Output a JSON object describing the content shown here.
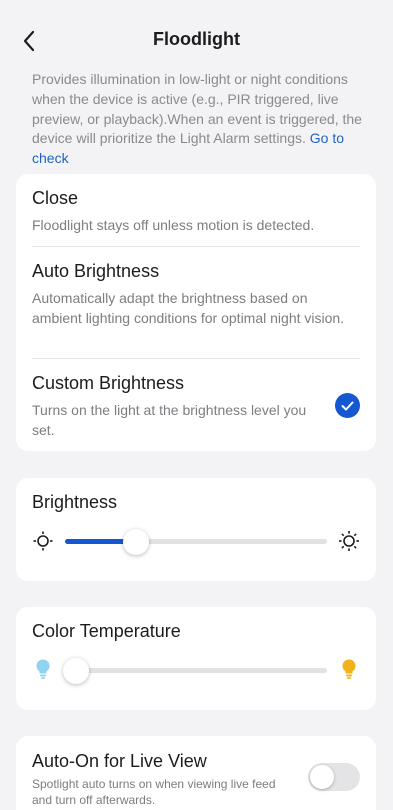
{
  "header": {
    "title": "Floodlight",
    "back_icon": "chevron-left-icon"
  },
  "description": {
    "text": "Provides illumination in low-light or night conditions when the device is active (e.g., PIR triggered, live preview, or playback).When an event is triggered, the device will prioritize the Light Alarm settings. ",
    "link": "Go to check"
  },
  "modes": [
    {
      "title": "Close",
      "subtitle": "Floodlight stays off unless motion is detected.",
      "selected": false
    },
    {
      "title": "Auto Brightness",
      "subtitle": "Automatically adapt the brightness based on ambient lighting conditions for optimal night vision.",
      "selected": false
    },
    {
      "title": "Custom Brightness",
      "subtitle": "Turns on the light at the brightness level you set.",
      "selected": true
    }
  ],
  "brightness": {
    "label": "Brightness",
    "value": 0.27,
    "min_icon": "sun-dim-icon",
    "max_icon": "sun-bright-icon"
  },
  "color_temperature": {
    "label": "Color Temperature",
    "value": 0.0,
    "min_icon": "cool-bulb-icon",
    "max_icon": "warm-bulb-icon"
  },
  "auto_on": {
    "title": "Auto-On for Live View",
    "subtitle": "Spotlight auto turns on when viewing live feed and turn off afterwards.",
    "enabled": false
  },
  "colors": {
    "accent": "#1457d0",
    "link": "#1e63c6",
    "cool_bulb": "#8fd3f0",
    "warm_bulb": "#f2b21b"
  }
}
